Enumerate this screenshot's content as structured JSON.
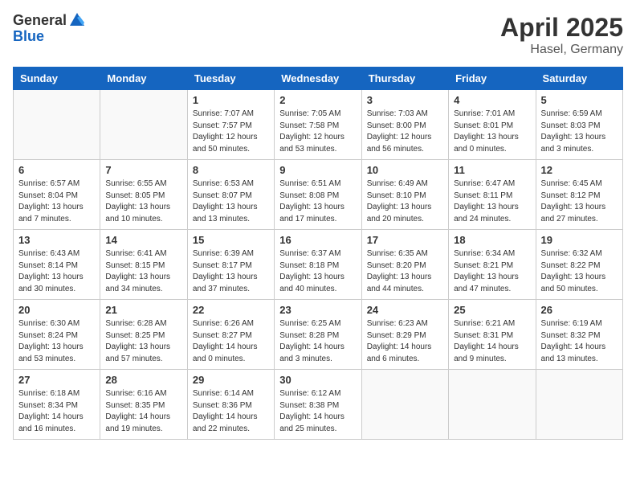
{
  "header": {
    "logo_general": "General",
    "logo_blue": "Blue",
    "month": "April 2025",
    "location": "Hasel, Germany"
  },
  "weekdays": [
    "Sunday",
    "Monday",
    "Tuesday",
    "Wednesday",
    "Thursday",
    "Friday",
    "Saturday"
  ],
  "weeks": [
    [
      {
        "day": "",
        "info": ""
      },
      {
        "day": "",
        "info": ""
      },
      {
        "day": "1",
        "info": "Sunrise: 7:07 AM\nSunset: 7:57 PM\nDaylight: 12 hours and 50 minutes."
      },
      {
        "day": "2",
        "info": "Sunrise: 7:05 AM\nSunset: 7:58 PM\nDaylight: 12 hours and 53 minutes."
      },
      {
        "day": "3",
        "info": "Sunrise: 7:03 AM\nSunset: 8:00 PM\nDaylight: 12 hours and 56 minutes."
      },
      {
        "day": "4",
        "info": "Sunrise: 7:01 AM\nSunset: 8:01 PM\nDaylight: 13 hours and 0 minutes."
      },
      {
        "day": "5",
        "info": "Sunrise: 6:59 AM\nSunset: 8:03 PM\nDaylight: 13 hours and 3 minutes."
      }
    ],
    [
      {
        "day": "6",
        "info": "Sunrise: 6:57 AM\nSunset: 8:04 PM\nDaylight: 13 hours and 7 minutes."
      },
      {
        "day": "7",
        "info": "Sunrise: 6:55 AM\nSunset: 8:05 PM\nDaylight: 13 hours and 10 minutes."
      },
      {
        "day": "8",
        "info": "Sunrise: 6:53 AM\nSunset: 8:07 PM\nDaylight: 13 hours and 13 minutes."
      },
      {
        "day": "9",
        "info": "Sunrise: 6:51 AM\nSunset: 8:08 PM\nDaylight: 13 hours and 17 minutes."
      },
      {
        "day": "10",
        "info": "Sunrise: 6:49 AM\nSunset: 8:10 PM\nDaylight: 13 hours and 20 minutes."
      },
      {
        "day": "11",
        "info": "Sunrise: 6:47 AM\nSunset: 8:11 PM\nDaylight: 13 hours and 24 minutes."
      },
      {
        "day": "12",
        "info": "Sunrise: 6:45 AM\nSunset: 8:12 PM\nDaylight: 13 hours and 27 minutes."
      }
    ],
    [
      {
        "day": "13",
        "info": "Sunrise: 6:43 AM\nSunset: 8:14 PM\nDaylight: 13 hours and 30 minutes."
      },
      {
        "day": "14",
        "info": "Sunrise: 6:41 AM\nSunset: 8:15 PM\nDaylight: 13 hours and 34 minutes."
      },
      {
        "day": "15",
        "info": "Sunrise: 6:39 AM\nSunset: 8:17 PM\nDaylight: 13 hours and 37 minutes."
      },
      {
        "day": "16",
        "info": "Sunrise: 6:37 AM\nSunset: 8:18 PM\nDaylight: 13 hours and 40 minutes."
      },
      {
        "day": "17",
        "info": "Sunrise: 6:35 AM\nSunset: 8:20 PM\nDaylight: 13 hours and 44 minutes."
      },
      {
        "day": "18",
        "info": "Sunrise: 6:34 AM\nSunset: 8:21 PM\nDaylight: 13 hours and 47 minutes."
      },
      {
        "day": "19",
        "info": "Sunrise: 6:32 AM\nSunset: 8:22 PM\nDaylight: 13 hours and 50 minutes."
      }
    ],
    [
      {
        "day": "20",
        "info": "Sunrise: 6:30 AM\nSunset: 8:24 PM\nDaylight: 13 hours and 53 minutes."
      },
      {
        "day": "21",
        "info": "Sunrise: 6:28 AM\nSunset: 8:25 PM\nDaylight: 13 hours and 57 minutes."
      },
      {
        "day": "22",
        "info": "Sunrise: 6:26 AM\nSunset: 8:27 PM\nDaylight: 14 hours and 0 minutes."
      },
      {
        "day": "23",
        "info": "Sunrise: 6:25 AM\nSunset: 8:28 PM\nDaylight: 14 hours and 3 minutes."
      },
      {
        "day": "24",
        "info": "Sunrise: 6:23 AM\nSunset: 8:29 PM\nDaylight: 14 hours and 6 minutes."
      },
      {
        "day": "25",
        "info": "Sunrise: 6:21 AM\nSunset: 8:31 PM\nDaylight: 14 hours and 9 minutes."
      },
      {
        "day": "26",
        "info": "Sunrise: 6:19 AM\nSunset: 8:32 PM\nDaylight: 14 hours and 13 minutes."
      }
    ],
    [
      {
        "day": "27",
        "info": "Sunrise: 6:18 AM\nSunset: 8:34 PM\nDaylight: 14 hours and 16 minutes."
      },
      {
        "day": "28",
        "info": "Sunrise: 6:16 AM\nSunset: 8:35 PM\nDaylight: 14 hours and 19 minutes."
      },
      {
        "day": "29",
        "info": "Sunrise: 6:14 AM\nSunset: 8:36 PM\nDaylight: 14 hours and 22 minutes."
      },
      {
        "day": "30",
        "info": "Sunrise: 6:12 AM\nSunset: 8:38 PM\nDaylight: 14 hours and 25 minutes."
      },
      {
        "day": "",
        "info": ""
      },
      {
        "day": "",
        "info": ""
      },
      {
        "day": "",
        "info": ""
      }
    ]
  ]
}
